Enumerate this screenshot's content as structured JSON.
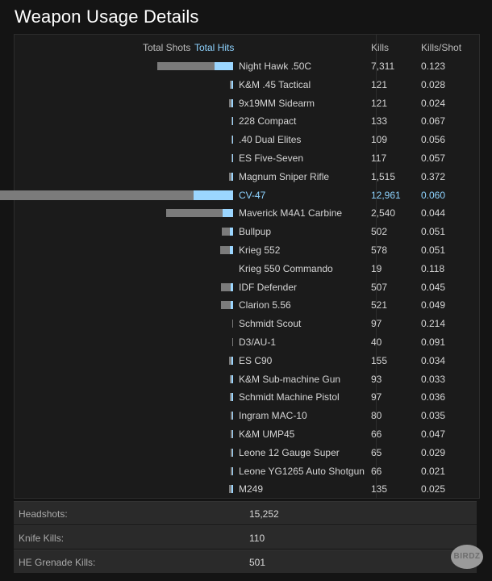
{
  "page": {
    "title": "Weapon Usage Details"
  },
  "table": {
    "headers": {
      "total_shots": "Total Shots",
      "total_hits": "Total Hits",
      "kills": "Kills",
      "kills_per_shot": "Kills/Shot"
    },
    "rows": [
      {
        "name": "Night Hawk .50C",
        "kills": "7,311",
        "kps": "0.123"
      },
      {
        "name": "K&M .45 Tactical",
        "kills": "121",
        "kps": "0.028"
      },
      {
        "name": "9x19MM Sidearm",
        "kills": "121",
        "kps": "0.024"
      },
      {
        "name": "228 Compact",
        "kills": "133",
        "kps": "0.067"
      },
      {
        "name": ".40 Dual Elites",
        "kills": "109",
        "kps": "0.056"
      },
      {
        "name": "ES Five-Seven",
        "kills": "117",
        "kps": "0.057"
      },
      {
        "name": "Magnum Sniper Rifle",
        "kills": "1,515",
        "kps": "0.372"
      },
      {
        "name": "CV-47",
        "kills": "12,961",
        "kps": "0.060",
        "highlight": true
      },
      {
        "name": "Maverick M4A1 Carbine",
        "kills": "2,540",
        "kps": "0.044"
      },
      {
        "name": "Bullpup",
        "kills": "502",
        "kps": "0.051"
      },
      {
        "name": "Krieg 552",
        "kills": "578",
        "kps": "0.051"
      },
      {
        "name": "Krieg 550 Commando",
        "kills": "19",
        "kps": "0.118"
      },
      {
        "name": "IDF Defender",
        "kills": "507",
        "kps": "0.045"
      },
      {
        "name": "Clarion 5.56",
        "kills": "521",
        "kps": "0.049"
      },
      {
        "name": "Schmidt Scout",
        "kills": "97",
        "kps": "0.214"
      },
      {
        "name": "D3/AU-1",
        "kills": "40",
        "kps": "0.091"
      },
      {
        "name": "ES C90",
        "kills": "155",
        "kps": "0.034"
      },
      {
        "name": "K&M Sub-machine Gun",
        "kills": "93",
        "kps": "0.033"
      },
      {
        "name": "Schmidt Machine Pistol",
        "kills": "97",
        "kps": "0.036"
      },
      {
        "name": "Ingram MAC-10",
        "kills": "80",
        "kps": "0.035"
      },
      {
        "name": "K&M UMP45",
        "kills": "66",
        "kps": "0.047"
      },
      {
        "name": "Leone 12 Gauge Super",
        "kills": "65",
        "kps": "0.029"
      },
      {
        "name": "Leone YG1265 Auto Shotgun",
        "kills": "66",
        "kps": "0.021"
      },
      {
        "name": "M249",
        "kills": "135",
        "kps": "0.025"
      }
    ]
  },
  "summary": [
    {
      "label": "Headshots:",
      "value": "15,252"
    },
    {
      "label": "Knife Kills:",
      "value": "110"
    },
    {
      "label": "HE Grenade Kills:",
      "value": "501"
    }
  ],
  "watermark": {
    "text": "BIRDZ"
  },
  "colors": {
    "hits_bar": "#9bd6ff",
    "shots_bar": "#7b7b7b",
    "highlight_text": "#8ed3ff"
  }
}
